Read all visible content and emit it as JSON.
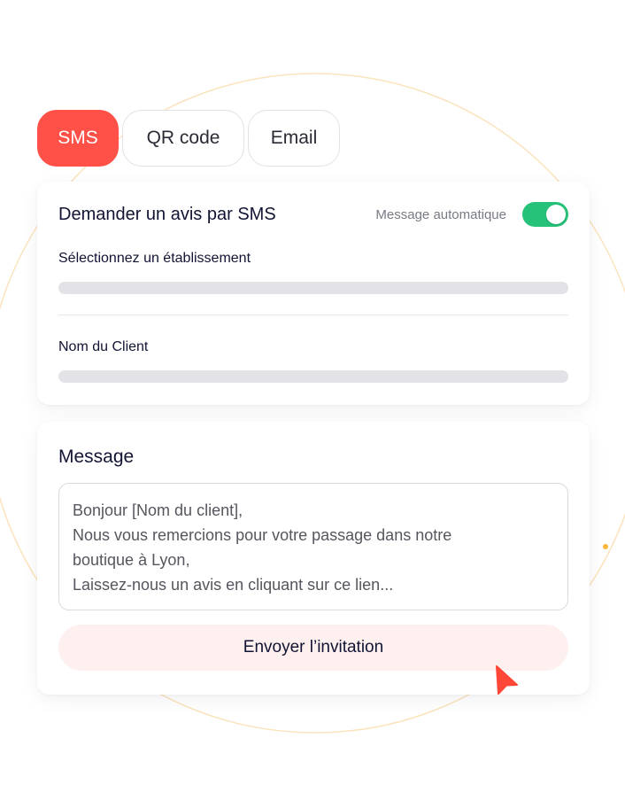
{
  "tabs": [
    {
      "label": "SMS",
      "active": true
    },
    {
      "label": "QR code",
      "active": false
    },
    {
      "label": "Email",
      "active": false
    }
  ],
  "sms_card": {
    "title": "Demander un avis par SMS",
    "auto_message_label": "Message automatique",
    "auto_message_enabled": true,
    "establishment_label": "Sélectionnez un établissement",
    "client_name_label": "Nom du Client"
  },
  "message_card": {
    "title": "Message",
    "lines": [
      "Bonjour [Nom du client],",
      "Nous vous remercions pour votre passage dans notre",
      "boutique à Lyon,",
      "Laissez-nous un avis en cliquant sur ce lien..."
    ],
    "send_button": "Envoyer l’invitation"
  },
  "icons": [
    "toggle-switch",
    "mouse-cursor-icon"
  ],
  "colors": {
    "accent": "#ff5148",
    "toggle_on": "#27c27a",
    "send_button_bg": "#fff0f0",
    "placeholder_bar": "#e2e2e7",
    "ring": "#fbe3bd"
  }
}
